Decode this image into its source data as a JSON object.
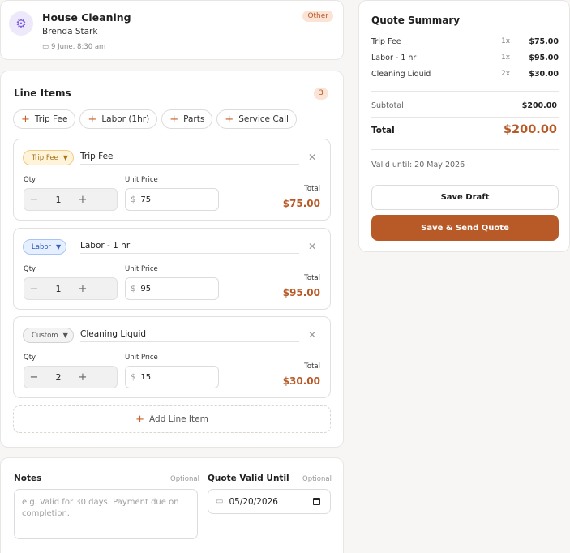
{
  "job": {
    "title": "House Cleaning",
    "client": "Brenda Stark",
    "date": "9 June, 8:30 am",
    "tag": "Other",
    "icon": "gear-icon"
  },
  "line_items_section": {
    "title": "Line Items",
    "count": "3",
    "quick_add": [
      "Trip Fee",
      "Labor (1hr)",
      "Parts",
      "Service Call"
    ],
    "add_line_label": "Add Line Item"
  },
  "labels": {
    "qty": "Qty",
    "unit_price": "Unit Price",
    "total": "Total",
    "currency": "$"
  },
  "items": [
    {
      "type": "Trip Fee",
      "name": "Trip Fee",
      "qty": "1",
      "price": "75",
      "total": "$75.00"
    },
    {
      "type": "Labor",
      "name": "Labor - 1 hr",
      "qty": "1",
      "price": "95",
      "total": "$95.00"
    },
    {
      "type": "Custom",
      "name": "Cleaning Liquid",
      "qty": "2",
      "price": "15",
      "total": "$30.00"
    }
  ],
  "notes": {
    "title": "Notes",
    "optional": "Optional",
    "placeholder": "e.g. Valid for 30 days. Payment due on completion."
  },
  "valid_until": {
    "title": "Quote Valid Until",
    "optional": "Optional",
    "value": "05/20/2026"
  },
  "summary": {
    "title": "Quote Summary",
    "rows": [
      {
        "name": "Trip Fee",
        "qty": "1x",
        "value": "$75.00"
      },
      {
        "name": "Labor - 1 hr",
        "qty": "1x",
        "value": "$95.00"
      },
      {
        "name": "Cleaning Liquid",
        "qty": "2x",
        "value": "$30.00"
      }
    ],
    "subtotal_label": "Subtotal",
    "subtotal": "$200.00",
    "total_label": "Total",
    "total": "$200.00",
    "valid_text": "Valid until: 20 May 2026",
    "save_draft": "Save Draft",
    "save_send": "Save & Send Quote"
  },
  "colors": {
    "accent": "#b85a28",
    "background": "#f7f6f4"
  }
}
